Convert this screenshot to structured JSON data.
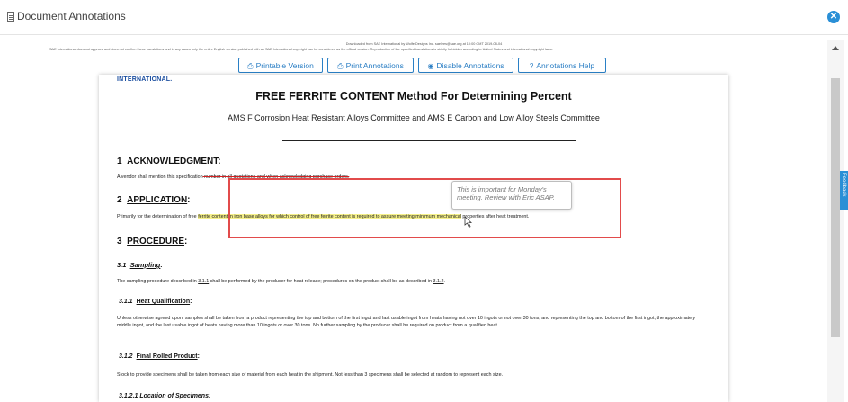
{
  "window": {
    "title": "Document Annotations",
    "close_icon": "close-icon",
    "title_icon": "document-icon"
  },
  "header": {
    "download_notice": "Downloaded from SAE International by Wolfe Designs Inc. saelees@sae.org at 10:00 GMT 2019-08-04",
    "disclaimer": "SAE International does not approve and does not confirm these translations and in any cases only the entire English version published with an SAE International copyright can be considered as the official version. Reproduction of the specified translations is strictly forbidden according to United States and international copyright laws."
  },
  "toolbar": {
    "printable_version": "Printable Version",
    "print_annotations": "Print Annotations",
    "disable_annotations": "Disable Annotations",
    "annotations_help": "Annotations Help"
  },
  "side_tab": {
    "label": "Feedback"
  },
  "document": {
    "brand": "INTERNATIONAL.",
    "title": "FREE FERRITE CONTENT Method For Determining Percent",
    "committee": "AMS F Corrosion Heat Resistant Alloys Committee and  AMS E Carbon and Low Alloy Steels Committee",
    "s1": {
      "num": "1",
      "label": "ACKNOWLEDGMENT",
      "colon": ":",
      "text_a": "A vendor shall mention this specification",
      "text_b": " number in all quotations and when acknowledging purchase orders."
    },
    "s2": {
      "num": "2",
      "label": "APPLICATION",
      "colon": ":",
      "text_a": "Primarily for the determination of free ",
      "text_b": "ferrite content in iron base alloys for which control of free ferrite content is required to assure meeting minimum mechanical",
      "text_c": " properties after heat treatment."
    },
    "s3": {
      "num": "3",
      "label": "PROCEDURE",
      "colon": ":"
    },
    "s31": {
      "num": "3.1",
      "label": "Sampling",
      "colon": ":",
      "text_a": "The sampling procedure described in ",
      "ref1": "3.1.1",
      "text_b": " shall be performed by the producer for heat release; procedures on the product shall be as described in ",
      "ref2": "3.1.2",
      "text_c": "."
    },
    "s311": {
      "num": "3.1.1",
      "label": "Heat Qualification",
      "colon": ":",
      "text": "Unless otherwise agreed upon, samples shall be taken from a product representing the top and bottom of the first ingot and last usable ingot from heats having not over 10 ingots or not over 30 tons; and representing the top and bottom of the first ingot, the approximately middle ingot, and the last usable ingot of heats having more than 10 ingots or over 30 tons. No further sampling by the producer shall be required on product from a qualified heat."
    },
    "s312": {
      "num": "3.1.2",
      "label": "Final Rolled Product",
      "colon": ":",
      "text": "Stock to provide specimens shall be taken from each size of material from each heat in the shipment. Not less than 3 specimens shall be selected at random to represent each size."
    },
    "s3121": {
      "label": "3.1.2.1 Location of Specimens:"
    }
  },
  "annotation": {
    "note": "This is important for Monday's meeting. Review with Eric ASAP."
  },
  "colors": {
    "accent": "#2a80c6",
    "annotation_box": "#e24b4b",
    "highlight": "#f5f08a",
    "strike": "#d32020"
  }
}
